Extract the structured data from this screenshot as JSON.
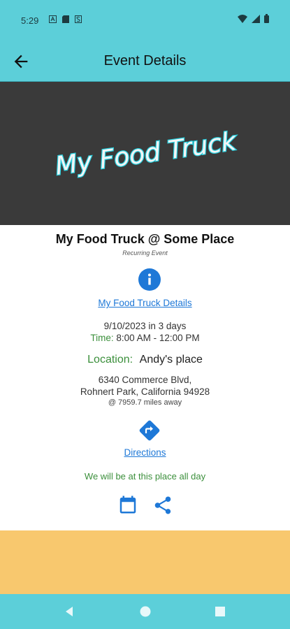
{
  "status_bar": {
    "time": "5:29",
    "icons_left": [
      "app-icon-a",
      "sd-card-icon",
      "s-icon"
    ],
    "icons_right": [
      "wifi-icon",
      "signal-icon",
      "battery-icon"
    ]
  },
  "app_bar": {
    "title": "Event Details",
    "back_icon": "arrow-left-icon",
    "background": "#5ccfd9"
  },
  "banner": {
    "logo_text": "My Food Truck",
    "background": "#3a3a3a"
  },
  "event": {
    "title": "My Food Truck @ Some Place",
    "subtitle": "Recurring Event",
    "details_link": "My Food Truck Details",
    "date_line": "9/10/2023 in 3 days",
    "time_label": "Time:",
    "time_value": "8:00 AM - 12:00 PM",
    "location_label": "Location:",
    "location_value": "Andy's place",
    "address_line1": "6340 Commerce Blvd,",
    "address_line2": "Rohnert Park, California 94928",
    "distance": "@ 7959.7 miles away",
    "directions_link": "Directions",
    "note": "We will be at this place all day"
  },
  "colors": {
    "accent": "#5ccfd9",
    "link": "#1e78d7",
    "green": "#3b8f3b",
    "footer": "#f8c86e"
  },
  "nav_bar": {
    "icons": [
      "nav-back-icon",
      "nav-home-icon",
      "nav-recents-icon"
    ]
  }
}
